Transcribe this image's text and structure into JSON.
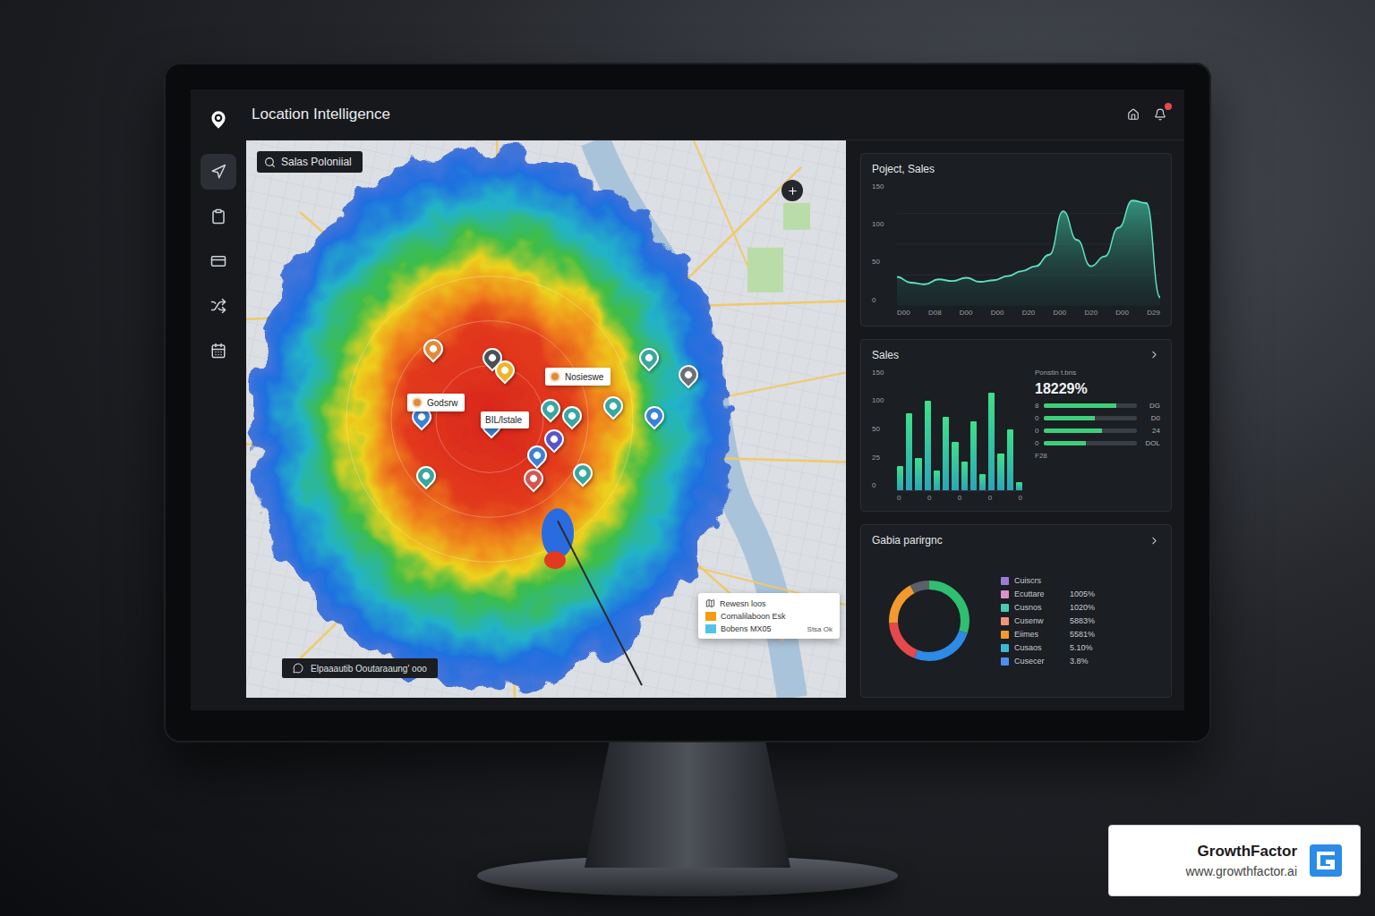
{
  "app": {
    "title": "Location Intelligence"
  },
  "sidebar": {
    "items": [
      {
        "selected": true
      },
      {
        "selected": false
      },
      {
        "selected": false
      },
      {
        "selected": false
      },
      {
        "selected": false
      }
    ]
  },
  "map": {
    "search": {
      "value": "Salas Poloniial"
    },
    "pins": [
      {
        "color": "#e08a3c"
      },
      {
        "color": "#4a4f58"
      },
      {
        "color": "#f0b429"
      },
      {
        "color": "#3aa6a0"
      },
      {
        "color": "#6b6f76"
      },
      {
        "color": "#3b82d6"
      },
      {
        "color": "#3b82d6"
      },
      {
        "color": "#3aa6a0"
      },
      {
        "color": "#3aa6a0"
      },
      {
        "color": "#3aa6a0"
      },
      {
        "color": "#3b82d6"
      },
      {
        "color": "#5a55c8"
      },
      {
        "color": "#3b82d6"
      },
      {
        "color": "#3aa6a0"
      },
      {
        "color": "#d9534f"
      },
      {
        "color": "#3aa6a0"
      }
    ],
    "labels": [
      {
        "text": "Godsrw",
        "color": "#e08a3c"
      },
      {
        "text": "Nosieswe",
        "color": "#e08a3c"
      },
      {
        "text": "BIL/lstale",
        "color": ""
      }
    ],
    "legend": {
      "title": "Rewesn loos",
      "items": [
        {
          "label": "Comalilaboon Esk",
          "color": "#f39c12"
        },
        {
          "label": "Bobens MX05",
          "color": "#4fc3e8"
        }
      ],
      "note": "Stsa Ok"
    },
    "caption": "Elpaaautib Ooutaraaung' ooo"
  },
  "project_sales": {
    "title": "Poject, Sales",
    "y_ticks": [
      "150",
      "100",
      "50",
      "0"
    ],
    "x_ticks": [
      "D00",
      "D08",
      "D00",
      "D00",
      "D20",
      "D00",
      "D20",
      "D00",
      "D29"
    ],
    "series": [
      35,
      28,
      26,
      32,
      30,
      34,
      29,
      31,
      36,
      42,
      48,
      62,
      115,
      80,
      48,
      60,
      95,
      128,
      125,
      10
    ]
  },
  "sales": {
    "title": "Sales",
    "y_ticks": [
      "150",
      "100",
      "50",
      "25",
      "0"
    ],
    "x_ticks": [
      "0",
      "0",
      "0",
      "0",
      "0"
    ],
    "series": [
      30,
      95,
      40,
      110,
      25,
      90,
      60,
      35,
      85,
      20,
      120,
      45,
      75,
      10
    ],
    "subtitle": "Ponstin t.bns",
    "value": "18229%",
    "rows": [
      {
        "label": "8",
        "level": 0.78,
        "reading": "DG",
        "color": "#3ecf7a"
      },
      {
        "label": "0",
        "level": 0.55,
        "reading": "D0",
        "color": "#3ecf7a"
      },
      {
        "label": "0",
        "level": 0.62,
        "reading": "24",
        "color": "#3ecf7a"
      },
      {
        "label": "0",
        "level": 0.45,
        "reading": "DOL",
        "color": "#3ecf7a"
      }
    ],
    "footnote": "F28"
  },
  "segments": {
    "title": "Gabia parirgnc",
    "donut": [
      {
        "value": 30,
        "color": "#2fbf71"
      },
      {
        "value": 26,
        "color": "#2d8ae6"
      },
      {
        "value": 18,
        "color": "#e5484d"
      },
      {
        "value": 18,
        "color": "#f29a2e"
      },
      {
        "value": 8,
        "color": "#5b6068"
      }
    ],
    "legend": [
      {
        "label": "Cuiscrs",
        "value": "",
        "color": "#9b7bd6"
      },
      {
        "label": "Ecuttare",
        "value": "1005%",
        "color": "#d891c9"
      },
      {
        "label": "Cusnos",
        "value": "1020%",
        "color": "#4cc9b0"
      },
      {
        "label": "Cusenw",
        "value": "5883%",
        "color": "#f0957a"
      },
      {
        "label": "Eiimes",
        "value": "5581%",
        "color": "#f29a2e"
      },
      {
        "label": "Cusaos",
        "value": "5.10%",
        "color": "#3bb8d8"
      },
      {
        "label": "Cusecer",
        "value": "3.8%",
        "color": "#4b8ff0"
      }
    ]
  },
  "watermark": {
    "brand": "GrowthFactor",
    "url": "www.growthfactor.ai"
  }
}
